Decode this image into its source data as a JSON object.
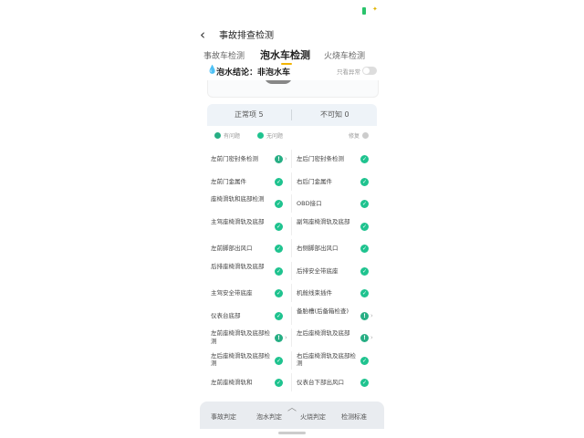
{
  "nav": {
    "title": "事故排查检测"
  },
  "tabs": [
    {
      "label": "事故车检测",
      "active": false
    },
    {
      "label": "泡水车检测",
      "active": true
    },
    {
      "label": "火烧车检测",
      "active": false
    }
  ],
  "summary": {
    "text": "泡水结论：非泡水车",
    "abnormal_only_label": "只看异常"
  },
  "stats": {
    "normal": "正常项 5",
    "unknown": "不可知 0"
  },
  "legend": {
    "a": "有问题",
    "b": "无问题",
    "c": "修复"
  },
  "checks": [
    {
      "left": {
        "label": "左前门密封条检测",
        "status": "warn"
      },
      "right": {
        "label": "左后门密封条检测",
        "status": "ok"
      }
    },
    {
      "left": {
        "label": "左前门金属件",
        "status": "ok"
      },
      "right": {
        "label": "右后门金属件",
        "status": "ok"
      }
    },
    {
      "left": {
        "label": "座椅滑轨和底部检测",
        "status": "ok"
      },
      "right": {
        "label": "OBD接口",
        "status": "ok"
      }
    },
    {
      "left": {
        "label": "主驾座椅滑轨及底部",
        "status": "ok"
      },
      "right": {
        "label": "副驾座椅滑轨及底部",
        "status": "ok"
      }
    },
    {
      "left": {
        "label": "左前脚部出风口",
        "status": "ok"
      },
      "right": {
        "label": "右侧脚部出风口",
        "status": "ok"
      }
    },
    {
      "left": {
        "label": "后排座椅滑轨及底部",
        "status": "ok"
      },
      "right": {
        "label": "后排安全带底座",
        "status": "ok"
      }
    },
    {
      "left": {
        "label": "主驾安全带底座",
        "status": "ok"
      },
      "right": {
        "label": "机舱线束插件",
        "status": "ok"
      }
    },
    {
      "left": {
        "label": "仪表台底部",
        "status": "ok"
      },
      "right": {
        "label": "备胎槽(后备箱检查)",
        "status": "warn"
      }
    },
    {
      "left": {
        "label": "左前座椅滑轨及底部检测",
        "status": "warn"
      },
      "right": {
        "label": "左后座椅滑轨及底部",
        "status": "warn"
      }
    },
    {
      "left": {
        "label": "左后座椅滑轨及底部检测",
        "status": "ok"
      },
      "right": {
        "label": "右后座椅滑轨及底部检测",
        "status": "ok"
      }
    },
    {
      "left": {
        "label": "左前座椅滑轨和",
        "status": "ok"
      },
      "right": {
        "label": "仪表台下部出风口",
        "status": "ok"
      }
    }
  ],
  "bottom_bar": [
    "事故判定",
    "泡水判定",
    "火烧判定",
    "检测标准"
  ]
}
